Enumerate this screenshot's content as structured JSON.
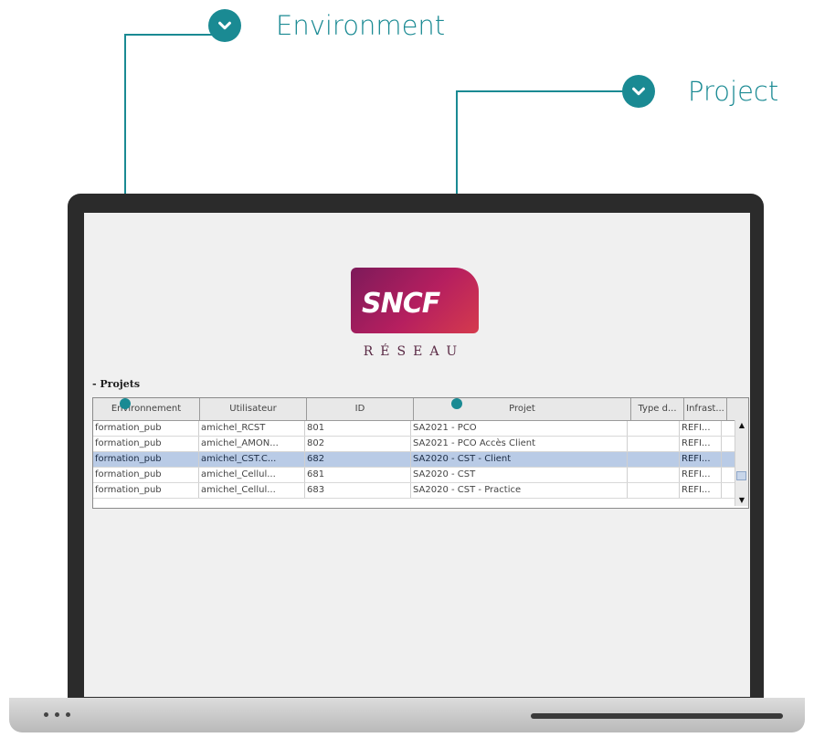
{
  "callouts": {
    "environment": "Environment",
    "project": "Project"
  },
  "logo": {
    "brand": "SNCF",
    "sub": "RÉSEAU"
  },
  "panel_title": "- Projets",
  "table": {
    "headers": [
      "Environnement",
      "Utilisateur",
      "ID",
      "Projet",
      "Type d...",
      "Infrast..."
    ],
    "rows": [
      [
        "formation_pub",
        "amichel_RCST",
        "801",
        "SA2021 - PCO",
        "",
        "REFI..."
      ],
      [
        "formation_pub",
        "amichel_AMON...",
        "802",
        "SA2021 - PCO Accès Client",
        "",
        "REFI..."
      ],
      [
        "formation_pub",
        "amichel_CST.C...",
        "682",
        "SA2020 - CST - Client",
        "",
        "REFI..."
      ],
      [
        "formation_pub",
        "amichel_Cellul...",
        "681",
        "SA2020 - CST",
        "",
        "REFI..."
      ],
      [
        "formation_pub",
        "amichel_Cellul...",
        "683",
        "SA2020 - CST - Practice",
        "",
        "REFI..."
      ]
    ],
    "selected_row": 2
  },
  "icons": {
    "callout": "chevron-down-icon",
    "scroll_up": "arrow-up-icon",
    "scroll_down": "arrow-down-icon"
  },
  "colors": {
    "accent": "#1a8a93",
    "selection": "#b9cbe6"
  }
}
